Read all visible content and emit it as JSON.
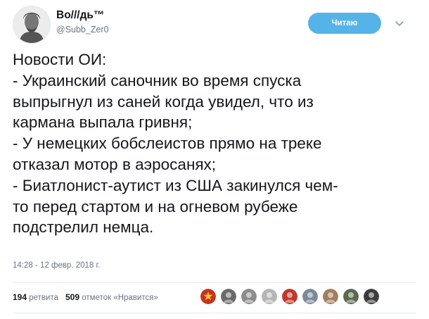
{
  "tweet": {
    "display_name": "Во///дь™",
    "handle": "@Subb_Zer0",
    "follow_label": "Читаю",
    "text_lines": [
      "Новости ОИ:",
      "- Украинский саночник во время спуска",
      "выпрыгнул из саней когда увидел, что из",
      "кармана выпала гривня;",
      "- У немецких бобслеистов прямо на треке",
      "отказал мотор в аэросанях;",
      "- Биатлонист-аутист из США закинулся чем-",
      "то перед стартом и на огневом рубеже",
      "подстрелил немца."
    ],
    "timestamp": "14:28 - 12 февр. 2018 г.",
    "retweets_count": "194",
    "retweets_label": "ретвита",
    "likes_count": "509",
    "likes_label": "отметок «Нравится»"
  },
  "likers": [
    {
      "icon": "ussr-emblem-avatar",
      "color": "#c8341c"
    },
    {
      "icon": "user-avatar",
      "color": "#6a6a6a"
    },
    {
      "icon": "user-avatar",
      "color": "#8c8c8c"
    },
    {
      "icon": "user-avatar",
      "color": "#b5b5b5"
    },
    {
      "icon": "user-avatar",
      "color": "#c0392b"
    },
    {
      "icon": "user-avatar",
      "color": "#7a8a99"
    },
    {
      "icon": "user-avatar",
      "color": "#a08060"
    },
    {
      "icon": "user-avatar",
      "color": "#5a6a50"
    },
    {
      "icon": "user-avatar",
      "color": "#3c3c3c"
    }
  ],
  "colors": {
    "follow_button": "#55b3e7",
    "secondary_text": "#657786",
    "primary_text": "#14171a"
  }
}
